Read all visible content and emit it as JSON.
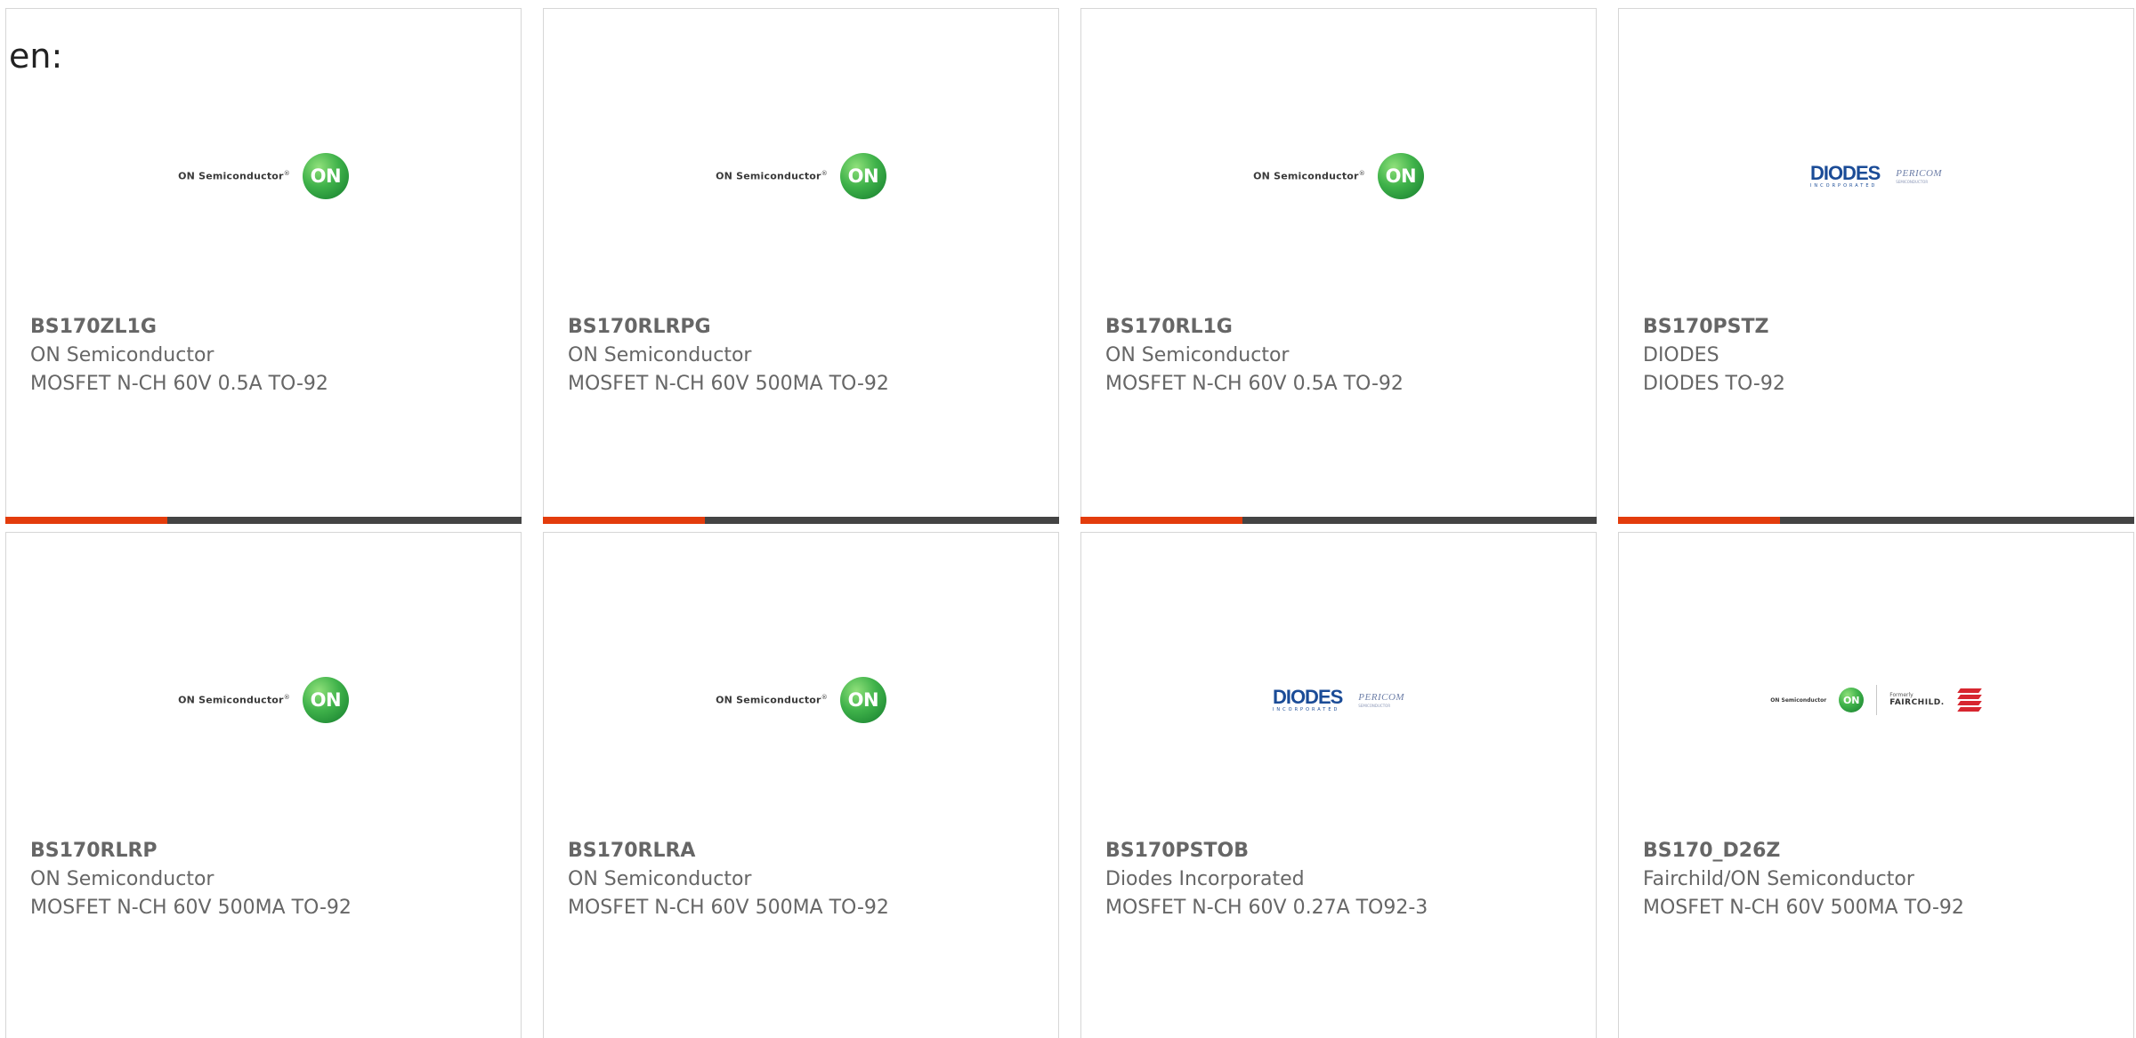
{
  "heading": "en:",
  "colors": {
    "accent": "#e33c0c",
    "bar_dark": "#444444",
    "card_border": "#d6d6d6",
    "text": "#666666",
    "on_green": "#3fb24a",
    "diodes_blue": "#1b4c97",
    "fairchild_red": "#d7262f"
  },
  "logos": {
    "on": {
      "wordmark": "ON Semiconductor",
      "mark": "ON"
    },
    "diodes": {
      "wordmark": "DIODES",
      "sub": "INCORPORATED",
      "partner": "PERICOM",
      "partner_sub": "SEMICONDUCTOR"
    },
    "fairchild": {
      "wordmark": "ON Semiconductor",
      "mark": "ON",
      "formerly": "Formerly",
      "brand": "FAIRCHILD."
    }
  },
  "cards": [
    {
      "part_number": "BS170ZL1G",
      "manufacturer": "ON Semiconductor",
      "description": "MOSFET N-CH 60V 0.5A TO-92",
      "logo": "on"
    },
    {
      "part_number": "BS170RLRPG",
      "manufacturer": "ON Semiconductor",
      "description": "MOSFET N-CH 60V 500MA TO-92",
      "logo": "on"
    },
    {
      "part_number": "BS170RL1G",
      "manufacturer": "ON Semiconductor",
      "description": "MOSFET N-CH 60V 0.5A TO-92",
      "logo": "on"
    },
    {
      "part_number": "BS170PSTZ",
      "manufacturer": "DIODES",
      "description": "DIODES TO-92",
      "logo": "diodes"
    },
    {
      "part_number": "BS170RLRP",
      "manufacturer": "ON Semiconductor",
      "description": "MOSFET N-CH 60V 500MA TO-92",
      "logo": "on"
    },
    {
      "part_number": "BS170RLRA",
      "manufacturer": "ON Semiconductor",
      "description": "MOSFET N-CH 60V 500MA TO-92",
      "logo": "on"
    },
    {
      "part_number": "BS170PSTOB",
      "manufacturer": "Diodes Incorporated",
      "description": "MOSFET N-CH 60V 0.27A TO92-3",
      "logo": "diodes"
    },
    {
      "part_number": "BS170_D26Z",
      "manufacturer": "Fairchild/ON Semiconductor",
      "description": "MOSFET N-CH 60V 500MA TO-92",
      "logo": "fairchild"
    }
  ]
}
